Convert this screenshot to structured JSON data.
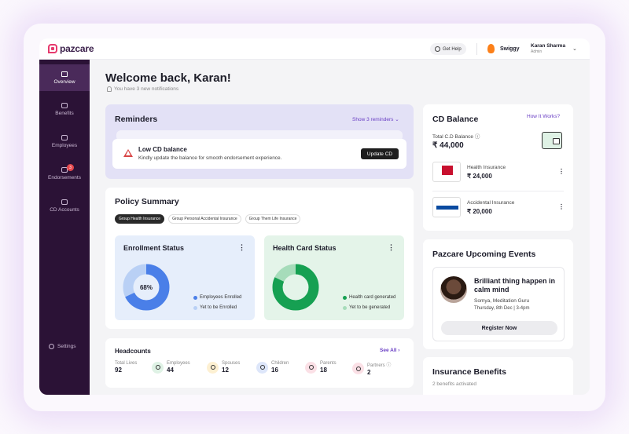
{
  "brand": {
    "name": "pazcare",
    "accent": "#e63a6d"
  },
  "topbar": {
    "help_label": "Get Help",
    "company": "Swiggy",
    "user_name": "Karan Sharma",
    "user_role": "Admin"
  },
  "sidebar": {
    "items": [
      {
        "label": "Overview",
        "icon": "home-icon"
      },
      {
        "label": "Benefits",
        "icon": "gift-icon"
      },
      {
        "label": "Employees",
        "icon": "users-icon"
      },
      {
        "label": "Endorsements",
        "icon": "endorsement-icon",
        "badge": "3"
      },
      {
        "label": "CD Accounts",
        "icon": "wallet-icon"
      }
    ],
    "settings_label": "Settings"
  },
  "welcome": {
    "title": "Welcome back, Karan!",
    "notifications": "You have 3 new notifications"
  },
  "reminders": {
    "title": "Reminders",
    "show_label": "Show 3 reminders",
    "item_title": "Low CD balance",
    "item_sub": "Kindly update the balance for smooth endorsement experience.",
    "action_label": "Update CD"
  },
  "policy": {
    "title": "Policy Summary",
    "chips": [
      "Group Health Insurance",
      "Group Personal Accidental Insurance",
      "Group Them Life Insurance"
    ],
    "enrollment": {
      "title": "Enrollment Status",
      "percent_label": "68%",
      "enrolled_fraction": 0.68,
      "legend_enrolled": "Employees Enrolled",
      "legend_pending": "Yet to be Enrolled",
      "colors": {
        "enrolled": "#4a7fe8",
        "pending": "#b9d0f5"
      }
    },
    "health_card": {
      "title": "Health Card Status",
      "generated_fraction": 0.82,
      "legend_generated": "Health card generated",
      "legend_pending": "Yet to be generated",
      "colors": {
        "generated": "#16a052",
        "pending": "#a6dcba"
      }
    }
  },
  "headcounts": {
    "title": "Headcounts",
    "see_all": "See All",
    "items": [
      {
        "label": "Total Lives",
        "value": "92"
      },
      {
        "label": "Employees",
        "value": "44"
      },
      {
        "label": "Spouses",
        "value": "12"
      },
      {
        "label": "Children",
        "value": "16"
      },
      {
        "label": "Parents",
        "value": "18"
      },
      {
        "label": "Partners",
        "value": "2"
      }
    ]
  },
  "cd_balance": {
    "title": "CD Balance",
    "how_label": "How It Works?",
    "total_label": "Total C.D Balance",
    "total_value": "₹ 44,000",
    "accounts": [
      {
        "name": "Health Insurance",
        "amount": "₹ 24,000",
        "logo": "aditya-birla-logo"
      },
      {
        "name": "Accidental Insurance",
        "amount": "₹ 20,000",
        "logo": "bajaj-allianz-logo"
      }
    ]
  },
  "events": {
    "title": "Pazcare Upcoming Events",
    "headline": "Brilliant thing happen in calm mind",
    "host": "Somya, Meditation Guru",
    "time": "Thursday, 8th Dec | 3-4pm",
    "register_label": "Register Now"
  },
  "benefits": {
    "title": "Insurance Benefits",
    "sub": "2 benefits activated"
  }
}
